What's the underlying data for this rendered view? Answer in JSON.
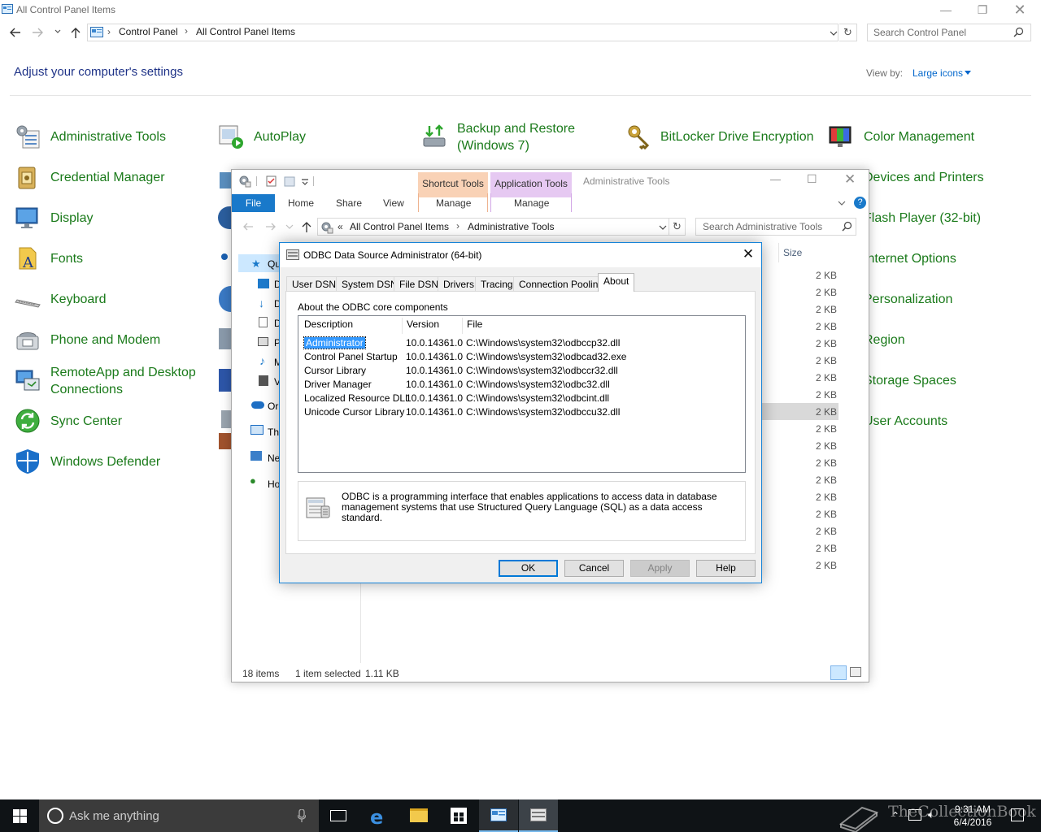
{
  "cp": {
    "window_title": "All Control Panel Items",
    "breadcrumb": [
      "Control Panel",
      "All Control Panel Items"
    ],
    "search_placeholder": "Search Control Panel",
    "heading": "Adjust your computer's settings",
    "view_by_label": "View by:",
    "view_by_value": "Large icons",
    "items_col1": [
      "Administrative Tools",
      "Credential Manager",
      "Display",
      "Fonts",
      "Keyboard",
      "Phone and Modem",
      "RemoteApp and Desktop",
      "Sync Center",
      "Windows Defender"
    ],
    "remoteapp_line2": "Connections",
    "items_col2": [
      "AutoPlay"
    ],
    "items_col3_line1": "Backup and Restore",
    "items_col3_line2": "(Windows 7)",
    "items_col4": [
      "BitLocker Drive Encryption"
    ],
    "items_col5": [
      "Color Management",
      "Devices and Printers",
      "Flash Player (32-bit)",
      "Internet Options",
      "Personalization",
      "Region",
      "Storage Spaces",
      "User Accounts"
    ]
  },
  "explorer": {
    "title": "Administrative Tools",
    "ctx_shortcut": "Shortcut Tools",
    "ctx_application": "Application Tools",
    "tab_file": "File",
    "tab_home": "Home",
    "tab_share": "Share",
    "tab_view": "View",
    "tab_manage1": "Manage",
    "tab_manage2": "Manage",
    "addr_prefix": "«",
    "addr_crumbs": [
      "All Control Panel Items",
      "Administrative Tools"
    ],
    "search_placeholder": "Search Administrative Tools",
    "nav_items": [
      "Qu",
      "D",
      "D",
      "D",
      "P",
      "M",
      "V",
      "Or",
      "Th",
      "Ne",
      "Ho"
    ],
    "size_header": "Size",
    "sizes": [
      "2 KB",
      "2 KB",
      "2 KB",
      "2 KB",
      "2 KB",
      "2 KB",
      "2 KB",
      "2 KB",
      "2 KB",
      "2 KB",
      "2 KB",
      "2 KB",
      "2 KB",
      "2 KB",
      "2 KB",
      "2 KB",
      "2 KB",
      "2 KB"
    ],
    "status_count": "18 items",
    "status_selected": "1 item selected",
    "status_size": "1.11 KB"
  },
  "odbc": {
    "title": "ODBC Data Source Administrator (64-bit)",
    "tabs": [
      "User DSN",
      "System DSN",
      "File DSN",
      "Drivers",
      "Tracing",
      "Connection Pooling",
      "About"
    ],
    "section_label": "About the ODBC core components",
    "columns": [
      "Description",
      "Version",
      "File"
    ],
    "rows": [
      [
        "Administrator",
        "10.0.14361.0",
        "C:\\Windows\\system32\\odbccp32.dll"
      ],
      [
        "Control Panel Startup",
        "10.0.14361.0",
        "C:\\Windows\\system32\\odbcad32.exe"
      ],
      [
        "Cursor Library",
        "10.0.14361.0",
        "C:\\Windows\\system32\\odbccr32.dll"
      ],
      [
        "Driver Manager",
        "10.0.14361.0",
        "C:\\Windows\\system32\\odbc32.dll"
      ],
      [
        "Localized Resource DLL",
        "10.0.14361.0",
        "C:\\Windows\\system32\\odbcint.dll"
      ],
      [
        "Unicode Cursor Library",
        "10.0.14361.0",
        "C:\\Windows\\system32\\odbccu32.dll"
      ]
    ],
    "info_text": "ODBC is a programming interface that enables applications to access data in database management systems that use Structured Query Language (SQL) as a data access standard.",
    "buttons": {
      "ok": "OK",
      "cancel": "Cancel",
      "apply": "Apply",
      "help": "Help"
    }
  },
  "taskbar": {
    "search_placeholder": "Ask me anything",
    "time": "9:31 AM",
    "date": "6/4/2016",
    "watermark": "TheCollectionBook"
  },
  "colors": {
    "cp_link_green": "#1a7a1a",
    "heading_blue": "#1e3287",
    "accent_blue": "#0078d7",
    "shortcut_tools_bg": "#f9d2b6",
    "application_tools_bg": "#e6c9f2",
    "selection_blue": "#3399ff",
    "taskbar_bg": "#0f1316"
  }
}
